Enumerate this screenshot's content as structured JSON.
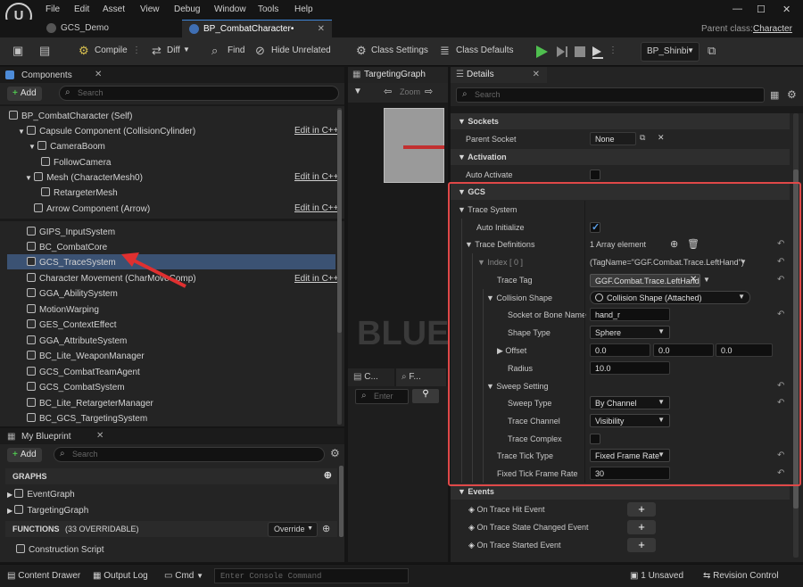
{
  "menu": {
    "items": [
      "File",
      "Edit",
      "Asset",
      "View",
      "Debug",
      "Window",
      "Tools",
      "Help"
    ],
    "parent_class_label": "Parent class:",
    "parent_class_value": "Character"
  },
  "tabs": [
    {
      "label": "GCS_Demo"
    },
    {
      "label": "BP_CombatCharacter•"
    }
  ],
  "toolbar": {
    "compile": "Compile",
    "diff": "Diff",
    "find": "Find",
    "hide_unrelated": "Hide Unrelated",
    "class_settings": "Class Settings",
    "class_defaults": "Class Defaults",
    "debug_object": "BP_Shinbi"
  },
  "components": {
    "title": "Components",
    "add": "Add",
    "search_placeholder": "Search",
    "self": "BP_CombatCharacter (Self)",
    "tree": [
      {
        "label": "Capsule Component (CollisionCylinder)",
        "edit": "Edit in C++"
      },
      {
        "label": "CameraBoom"
      },
      {
        "label": "FollowCamera"
      },
      {
        "label": "Mesh (CharacterMesh0)",
        "edit": "Edit in C++"
      },
      {
        "label": "RetargeterMesh"
      },
      {
        "label": "Arrow Component (Arrow)",
        "edit": "Edit in C++"
      }
    ],
    "list": [
      {
        "label": "GIPS_InputSystem"
      },
      {
        "label": "BC_CombatCore"
      },
      {
        "label": "GCS_TraceSystem"
      },
      {
        "label": "Character Movement (CharMoveComp)",
        "edit": "Edit in C++"
      },
      {
        "label": "GGA_AbilitySystem"
      },
      {
        "label": "MotionWarping"
      },
      {
        "label": "GES_ContextEffect"
      },
      {
        "label": "GGA_AttributeSystem"
      },
      {
        "label": "BC_Lite_WeaponManager"
      },
      {
        "label": "GCS_CombatTeamAgent"
      },
      {
        "label": "GCS_CombatSystem"
      },
      {
        "label": "BC_Lite_RetargeterManager"
      },
      {
        "label": "BC_GCS_TargetingSystem"
      }
    ]
  },
  "my_blueprint": {
    "title": "My Blueprint",
    "add": "Add",
    "search_placeholder": "Search",
    "graphs_header": "GRAPHS",
    "graphs": [
      "EventGraph",
      "TargetingGraph"
    ],
    "functions_header": "FUNCTIONS",
    "functions_count": "(33 OVERRIDABLE)",
    "override": "Override",
    "functions": [
      "Construction Script"
    ]
  },
  "graph": {
    "tab": "TargetingGraph",
    "watermark": "BLUEP",
    "zoom_text": "Zoom",
    "sub_tab_1": "C...",
    "sub_tab_2": "F...",
    "enter_placeholder": "Enter"
  },
  "details": {
    "title": "Details",
    "search_placeholder": "Search",
    "sockets": {
      "header": "Sockets",
      "parent_socket_label": "Parent Socket",
      "parent_socket_value": "None"
    },
    "activation": {
      "header": "Activation",
      "auto_activate_label": "Auto Activate",
      "auto_activate": false
    },
    "gcs": {
      "header": "GCS",
      "trace_system": "Trace System",
      "auto_initialize_label": "Auto Initialize",
      "auto_initialize": true,
      "trace_defs_label": "Trace Definitions",
      "trace_defs_value": "1 Array element",
      "index_label": "Index [ 0 ]",
      "index_value": "(TagName=\"GGF.Combat.Trace.LeftHand\")",
      "trace_tag_label": "Trace Tag",
      "trace_tag_value": "GGF.Combat.Trace.LeftHand",
      "collision_shape_label": "Collision Shape",
      "collision_shape_value": "Collision Shape (Attached)",
      "socket_label": "Socket or Bone Name",
      "socket_value": "hand_r",
      "shape_type_label": "Shape Type",
      "shape_type_value": "Sphere",
      "offset_label": "Offset",
      "offset_x": "0.0",
      "offset_y": "0.0",
      "offset_z": "0.0",
      "radius_label": "Radius",
      "radius_value": "10.0",
      "sweep_setting_label": "Sweep Setting",
      "sweep_type_label": "Sweep Type",
      "sweep_type_value": "By Channel",
      "trace_channel_label": "Trace Channel",
      "trace_channel_value": "Visibility",
      "trace_complex_label": "Trace Complex",
      "trace_complex": false,
      "tick_type_label": "Trace Tick Type",
      "tick_type_value": "Fixed Frame Rate",
      "tick_rate_label": "Fixed Tick Frame Rate",
      "tick_rate_value": "30"
    },
    "events": {
      "header": "Events",
      "items": [
        "On Trace Hit Event",
        "On Trace State Changed Event",
        "On Trace Started Event"
      ]
    }
  },
  "statusbar": {
    "content_drawer": "Content Drawer",
    "output_log": "Output Log",
    "cmd": "Cmd",
    "console_placeholder": "Enter Console Command",
    "unsaved": "1 Unsaved",
    "revision": "Revision Control"
  },
  "colors": {
    "accent": "#3d86d8",
    "highlight_box": "#e04848",
    "selection": "#3b5273",
    "play_green": "#4fbf4f"
  }
}
